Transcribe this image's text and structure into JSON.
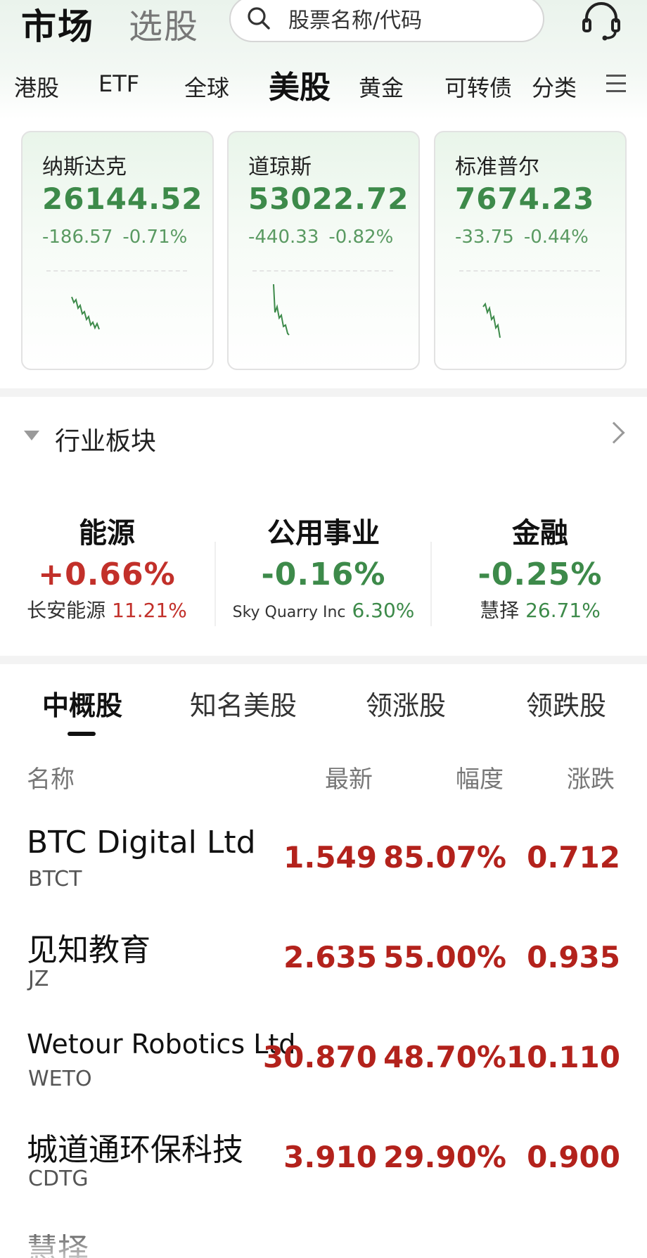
{
  "header": {
    "title": "市场",
    "subtitle": "选股",
    "search_placeholder": "股票名称/代码"
  },
  "market_tabs": [
    "港股",
    "ETF",
    "全球",
    "美股",
    "黄金",
    "可转债",
    "分类"
  ],
  "active_market_tab": "美股",
  "indices": [
    {
      "name": "纳斯达克",
      "value": "26144.52",
      "change": "-186.57",
      "change_pct": "-0.71%"
    },
    {
      "name": "道琼斯",
      "value": "53022.72",
      "change": "-440.33",
      "change_pct": "-0.82%"
    },
    {
      "name": "标准普尔",
      "value": "7674.23",
      "change": "-33.75",
      "change_pct": "-0.44%"
    }
  ],
  "sectors": {
    "title": "行业板块",
    "items": [
      {
        "name": "能源",
        "pct": "+0.66%",
        "direction": "up",
        "lead_name": "长安能源",
        "lead_pct": "11.21%"
      },
      {
        "name": "公用事业",
        "pct": "-0.16%",
        "direction": "down",
        "lead_name": "Sky Quarry Inc",
        "lead_pct": "6.30%"
      },
      {
        "name": "金融",
        "pct": "-0.25%",
        "direction": "down",
        "lead_name": "慧择",
        "lead_pct": "26.71%"
      }
    ]
  },
  "stock_tabs": [
    "中概股",
    "知名美股",
    "领涨股",
    "领跌股"
  ],
  "active_stock_tab": "中概股",
  "columns": {
    "name": "名称",
    "price": "最新",
    "pct": "幅度",
    "change": "涨跌"
  },
  "stocks": [
    {
      "name": "BTC Digital Ltd",
      "code": "BTCT",
      "price": "1.549",
      "pct": "85.07%",
      "change": "0.712"
    },
    {
      "name": "见知教育",
      "code": "JZ",
      "price": "2.635",
      "pct": "55.00%",
      "change": "0.935"
    },
    {
      "name": "Wetour Robotics Ltd",
      "code": "WETO",
      "price": "30.870",
      "pct": "48.70%",
      "change": "10.110"
    },
    {
      "name": "城道通环保科技",
      "code": "CDTG",
      "price": "3.910",
      "pct": "29.90%",
      "change": "0.900"
    },
    {
      "name": "慧择",
      "code": "",
      "price": "",
      "pct": "",
      "change": ""
    }
  ],
  "colors": {
    "up": "#c2302a",
    "down": "#3d8a4a",
    "stock_up": "#b3221c",
    "header_bg": "#eaf3ec"
  },
  "icons": [
    "search-icon",
    "headset-icon",
    "menu-icon",
    "triangle-down-icon",
    "chevron-right-icon"
  ]
}
